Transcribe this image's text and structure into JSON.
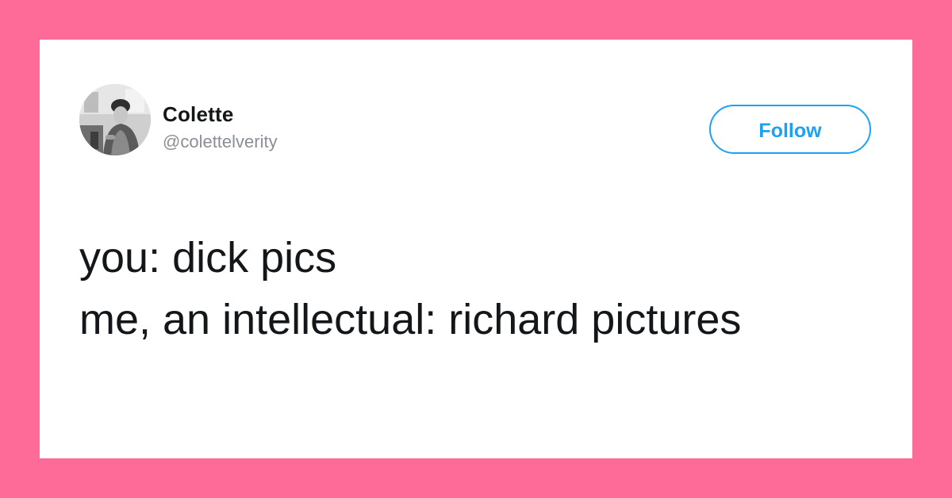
{
  "colors": {
    "background": "#ff6b98",
    "card": "#ffffff",
    "accent": "#1da1f2",
    "text_primary": "#14171a",
    "text_secondary": "#8a8f95"
  },
  "tweet": {
    "author": {
      "display_name": "Colette",
      "handle": "@colettelverity",
      "avatar_icon": "profile-photo"
    },
    "follow_label": "Follow",
    "lines": [
      "you: dick pics",
      "me, an intellectual: richard pictures"
    ]
  }
}
